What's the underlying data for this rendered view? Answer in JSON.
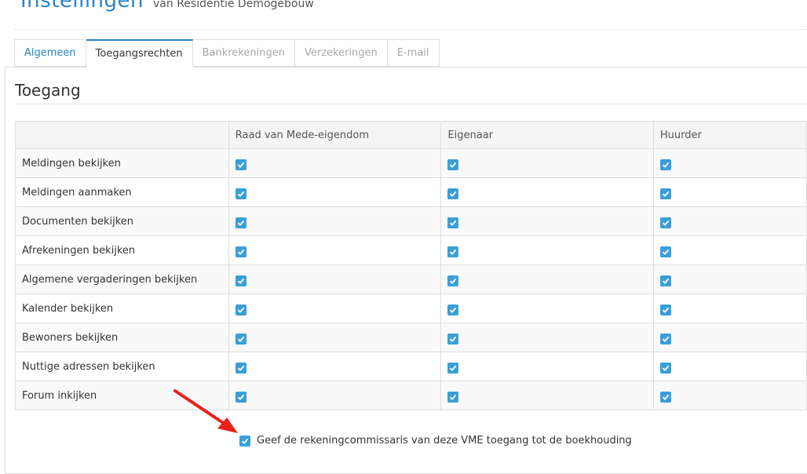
{
  "header": {
    "title": "Instellingen",
    "subtitle": "van Residentie Demogebouw"
  },
  "tabs": [
    {
      "label": "Algemeen"
    },
    {
      "label": "Toegangsrechten"
    },
    {
      "label": "Bankrekeningen"
    },
    {
      "label": "Verzekeringen"
    },
    {
      "label": "E-mail"
    }
  ],
  "section": {
    "title": "Toegang"
  },
  "table": {
    "columns": [
      "",
      "Raad van Mede-eigendom",
      "Eigenaar",
      "Huurder"
    ],
    "rows": [
      {
        "label": "Meldingen bekijken",
        "raad": true,
        "eigenaar": true,
        "huurder": true
      },
      {
        "label": "Meldingen aanmaken",
        "raad": true,
        "eigenaar": true,
        "huurder": true
      },
      {
        "label": "Documenten bekijken",
        "raad": true,
        "eigenaar": true,
        "huurder": true
      },
      {
        "label": "Afrekeningen bekijken",
        "raad": true,
        "eigenaar": true,
        "huurder": true
      },
      {
        "label": "Algemene vergaderingen bekijken",
        "raad": true,
        "eigenaar": true,
        "huurder": true
      },
      {
        "label": "Kalender bekijken",
        "raad": true,
        "eigenaar": true,
        "huurder": true
      },
      {
        "label": "Bewoners bekijken",
        "raad": true,
        "eigenaar": true,
        "huurder": true
      },
      {
        "label": "Nuttige adressen bekijken",
        "raad": true,
        "eigenaar": true,
        "huurder": true
      },
      {
        "label": "Forum inkijken",
        "raad": true,
        "eigenaar": true,
        "huurder": true
      }
    ]
  },
  "bottom_option": {
    "label": "Geef de rekeningcommissaris van deze VME toegang tot de boekhouding",
    "checked": true
  },
  "colors": {
    "accent": "#2a83c6",
    "checkbox": "#3a9fd8",
    "annotation_arrow": "#e8211b"
  }
}
